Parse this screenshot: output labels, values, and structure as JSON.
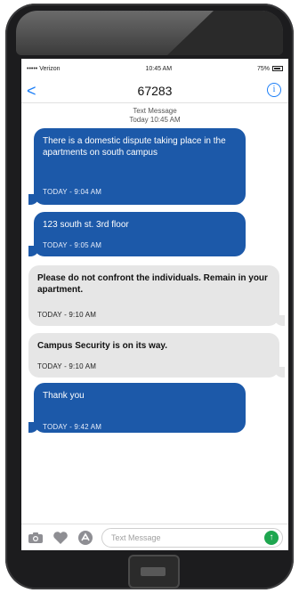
{
  "status": {
    "carrier": "••••• Verizon",
    "time": "10:45 AM",
    "battery": "75%"
  },
  "nav": {
    "back_label": "<",
    "title": "67283",
    "info_label": "i"
  },
  "header": {
    "line1": "Text Message",
    "line2": "Today 10:45 AM"
  },
  "messages": [
    {
      "side": "left",
      "text": "There is a domestic dispute taking place in the apartments on south campus",
      "time": "TODAY - 9:04 AM"
    },
    {
      "side": "left",
      "text": "123 south st. 3rd floor",
      "time": "TODAY - 9:05 AM"
    },
    {
      "side": "right",
      "text": "Please do not confront the individuals. Remain in your apartment.",
      "time": "TODAY - 9:10 AM"
    },
    {
      "side": "right",
      "text": "Campus Security is on its way.",
      "time": "TODAY - 9:10 AM"
    },
    {
      "side": "left",
      "text": "Thank you",
      "time": "TODAY - 9:42 AM"
    }
  ],
  "input": {
    "placeholder": "Text Message",
    "icons": [
      "camera-icon",
      "heart-icon",
      "app-store-icon",
      "send-arrow-icon"
    ]
  },
  "colors": {
    "accent": "#1b7ef7",
    "bubble_blue": "#1c59a9",
    "bubble_gray": "#e6e6e6",
    "send_green": "#1ea64f"
  }
}
